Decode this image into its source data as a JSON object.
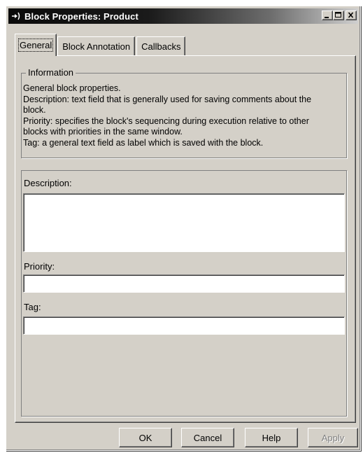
{
  "window": {
    "title": "Block Properties: Product",
    "minimize_icon": "minimize-icon",
    "maximize_icon": "maximize-icon",
    "close_icon": "close-icon"
  },
  "tabs": [
    {
      "label": "General",
      "active": true
    },
    {
      "label": "Block Annotation",
      "active": false
    },
    {
      "label": "Callbacks",
      "active": false
    }
  ],
  "information": {
    "legend": "Information",
    "lines": [
      "General block properties.",
      "Description: text field that is generally used for saving comments about the",
      "block.",
      "Priority: specifies the block's sequencing during execution relative to other",
      "blocks with priorities in the same window.",
      "Tag: a general text field as label which is saved with the block."
    ]
  },
  "form": {
    "description_label": "Description:",
    "description_value": "",
    "priority_label": "Priority:",
    "priority_value": "",
    "tag_label": "Tag:",
    "tag_value": ""
  },
  "buttons": {
    "ok": "OK",
    "cancel": "Cancel",
    "help": "Help",
    "apply": "Apply"
  },
  "colors": {
    "face": "#d4d0c8",
    "titlebar_start": "#0a0a0a",
    "titlebar_end": "#cfcfcf",
    "disabled_text": "#808080"
  }
}
